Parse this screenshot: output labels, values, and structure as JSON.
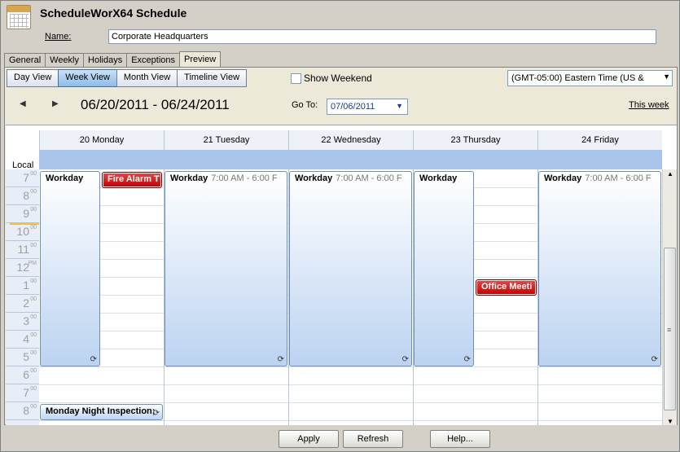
{
  "header": {
    "title": "ScheduleWorX64 Schedule",
    "name_label": "Name:",
    "name_value": "Corporate Headquarters"
  },
  "tabs": [
    {
      "label": "General"
    },
    {
      "label": "Weekly"
    },
    {
      "label": "Holidays"
    },
    {
      "label": "Exceptions"
    },
    {
      "label": "Preview",
      "active": true
    }
  ],
  "views": [
    {
      "label": "Day View"
    },
    {
      "label": "Week View",
      "active": true
    },
    {
      "label": "Month View"
    },
    {
      "label": "Timeline View"
    }
  ],
  "show_weekend_label": "Show Weekend",
  "timezone": "(GMT-05:00) Eastern Time (US &",
  "range_label": "06/20/2011 - 06/24/2011",
  "goto_label": "Go To:",
  "goto_value": "07/06/2011",
  "this_week_label": "This week",
  "local_label": "Local",
  "days": [
    "20 Monday",
    "21 Tuesday",
    "22 Wednesday",
    "23 Thursday",
    "24 Friday"
  ],
  "hours": [
    {
      "h": "7",
      "m": "00"
    },
    {
      "h": "8",
      "m": "00"
    },
    {
      "h": "9",
      "m": "00"
    },
    {
      "h": "10",
      "m": "00"
    },
    {
      "h": "11",
      "m": "00"
    },
    {
      "h": "12",
      "m": "PM"
    },
    {
      "h": "1",
      "m": "00"
    },
    {
      "h": "2",
      "m": "00"
    },
    {
      "h": "3",
      "m": "00"
    },
    {
      "h": "4",
      "m": "00"
    },
    {
      "h": "5",
      "m": "00"
    },
    {
      "h": "6",
      "m": "00"
    },
    {
      "h": "7",
      "m": "00"
    },
    {
      "h": "8",
      "m": "00"
    }
  ],
  "appointments": {
    "mon_workday": {
      "title": "Workday",
      "time": ""
    },
    "mon_fire": {
      "title": "Fire Alarm T"
    },
    "tue_workday": {
      "title": "Workday",
      "time": "7:00 AM - 6:00 F"
    },
    "wed_workday": {
      "title": "Workday",
      "time": "7:00 AM - 6:00 F"
    },
    "thu_workday": {
      "title": "Workday",
      "time": ""
    },
    "thu_office": {
      "title": "Office Meeti"
    },
    "fri_workday": {
      "title": "Workday",
      "time": "7:00 AM - 6:00 F"
    },
    "mon_night": {
      "title": "Monday Night Inspection;"
    }
  },
  "footer": {
    "apply": "Apply",
    "refresh": "Refresh",
    "help": "Help..."
  },
  "colors": {
    "appointment_fill": "#bcd3f1",
    "alert_fill": "#c00000",
    "allday_strip": "#a8c4ea"
  }
}
